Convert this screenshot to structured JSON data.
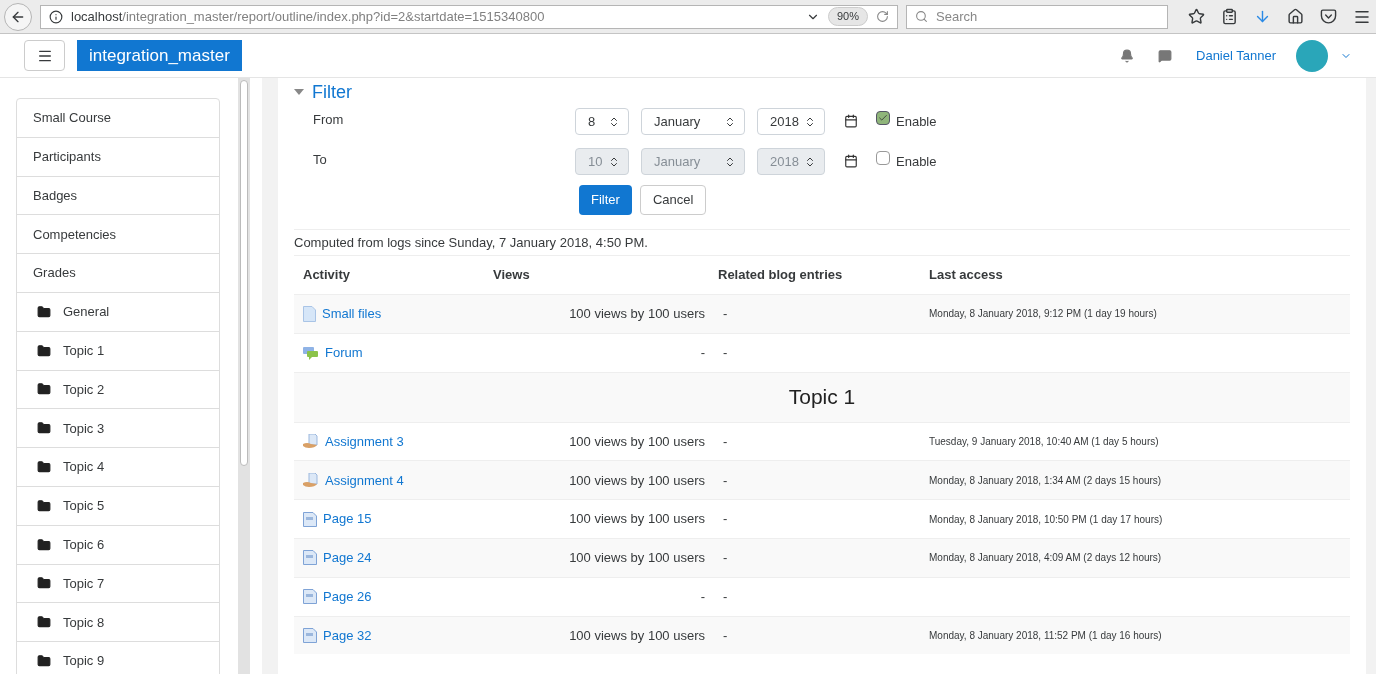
{
  "browser": {
    "url_host": "localhost",
    "url_path": "/integration_master/report/outline/index.php?id=2&startdate=1515340800",
    "zoom": "90%",
    "search_placeholder": "Search"
  },
  "header": {
    "site_name": "integration_master",
    "user_name": "Daniel Tanner"
  },
  "nav": [
    {
      "label": "Small Course",
      "kind": "link"
    },
    {
      "label": "Participants",
      "kind": "link"
    },
    {
      "label": "Badges",
      "kind": "link"
    },
    {
      "label": "Competencies",
      "kind": "link"
    },
    {
      "label": "Grades",
      "kind": "link"
    },
    {
      "label": "General",
      "kind": "folder"
    },
    {
      "label": "Topic 1",
      "kind": "folder"
    },
    {
      "label": "Topic 2",
      "kind": "folder"
    },
    {
      "label": "Topic 3",
      "kind": "folder"
    },
    {
      "label": "Topic 4",
      "kind": "folder"
    },
    {
      "label": "Topic 5",
      "kind": "folder"
    },
    {
      "label": "Topic 6",
      "kind": "folder"
    },
    {
      "label": "Topic 7",
      "kind": "folder"
    },
    {
      "label": "Topic 8",
      "kind": "folder"
    },
    {
      "label": "Topic 9",
      "kind": "folder"
    }
  ],
  "filter": {
    "title": "Filter",
    "expanded": true,
    "rows": [
      {
        "label": "From",
        "day": "8",
        "month": "January",
        "year": "2018",
        "enable_label": "Enable",
        "enabled": true
      },
      {
        "label": "To",
        "day": "10",
        "month": "January",
        "year": "2018",
        "enable_label": "Enable",
        "enabled": false
      }
    ],
    "submit": "Filter",
    "cancel": "Cancel"
  },
  "note": "Computed from logs since Sunday, 7 January 2018, 4:50 PM.",
  "table": {
    "columns": [
      "Activity",
      "Views",
      "Related blog entries",
      "Last access"
    ],
    "rows": [
      {
        "kind": "file",
        "name": "Small files",
        "views": "100 views by 100 users",
        "blog": "-",
        "last_access": "Monday, 8 January 2018, 9:12 PM (1 day 19 hours)"
      },
      {
        "kind": "forum",
        "name": "Forum",
        "views": "-",
        "blog": "-"
      },
      {
        "kind": "section",
        "title": "Topic 1"
      },
      {
        "kind": "assignment",
        "name": "Assignment 3",
        "views": "100 views by 100 users",
        "blog": "-",
        "last_access": "Tuesday, 9 January 2018, 10:40 AM (1 day 5 hours)"
      },
      {
        "kind": "assignment",
        "name": "Assignment 4",
        "views": "100 views by 100 users",
        "blog": "-",
        "last_access": "Monday, 8 January 2018, 1:34 AM (2 days 15 hours)"
      },
      {
        "kind": "page",
        "name": "Page 15",
        "views": "100 views by 100 users",
        "blog": "-",
        "last_access": "Monday, 8 January 2018, 10:50 PM (1 day 17 hours)"
      },
      {
        "kind": "page",
        "name": "Page 24",
        "views": "100 views by 100 users",
        "blog": "-",
        "last_access": "Monday, 8 January 2018, 4:09 AM (2 days 12 hours)"
      },
      {
        "kind": "page",
        "name": "Page 26",
        "views": "-",
        "blog": "-"
      },
      {
        "kind": "page",
        "name": "Page 32",
        "views": "100 views by 100 users",
        "blog": "-",
        "last_access": "Monday, 8 January 2018, 11:52 PM (1 day 16 hours)"
      }
    ]
  }
}
